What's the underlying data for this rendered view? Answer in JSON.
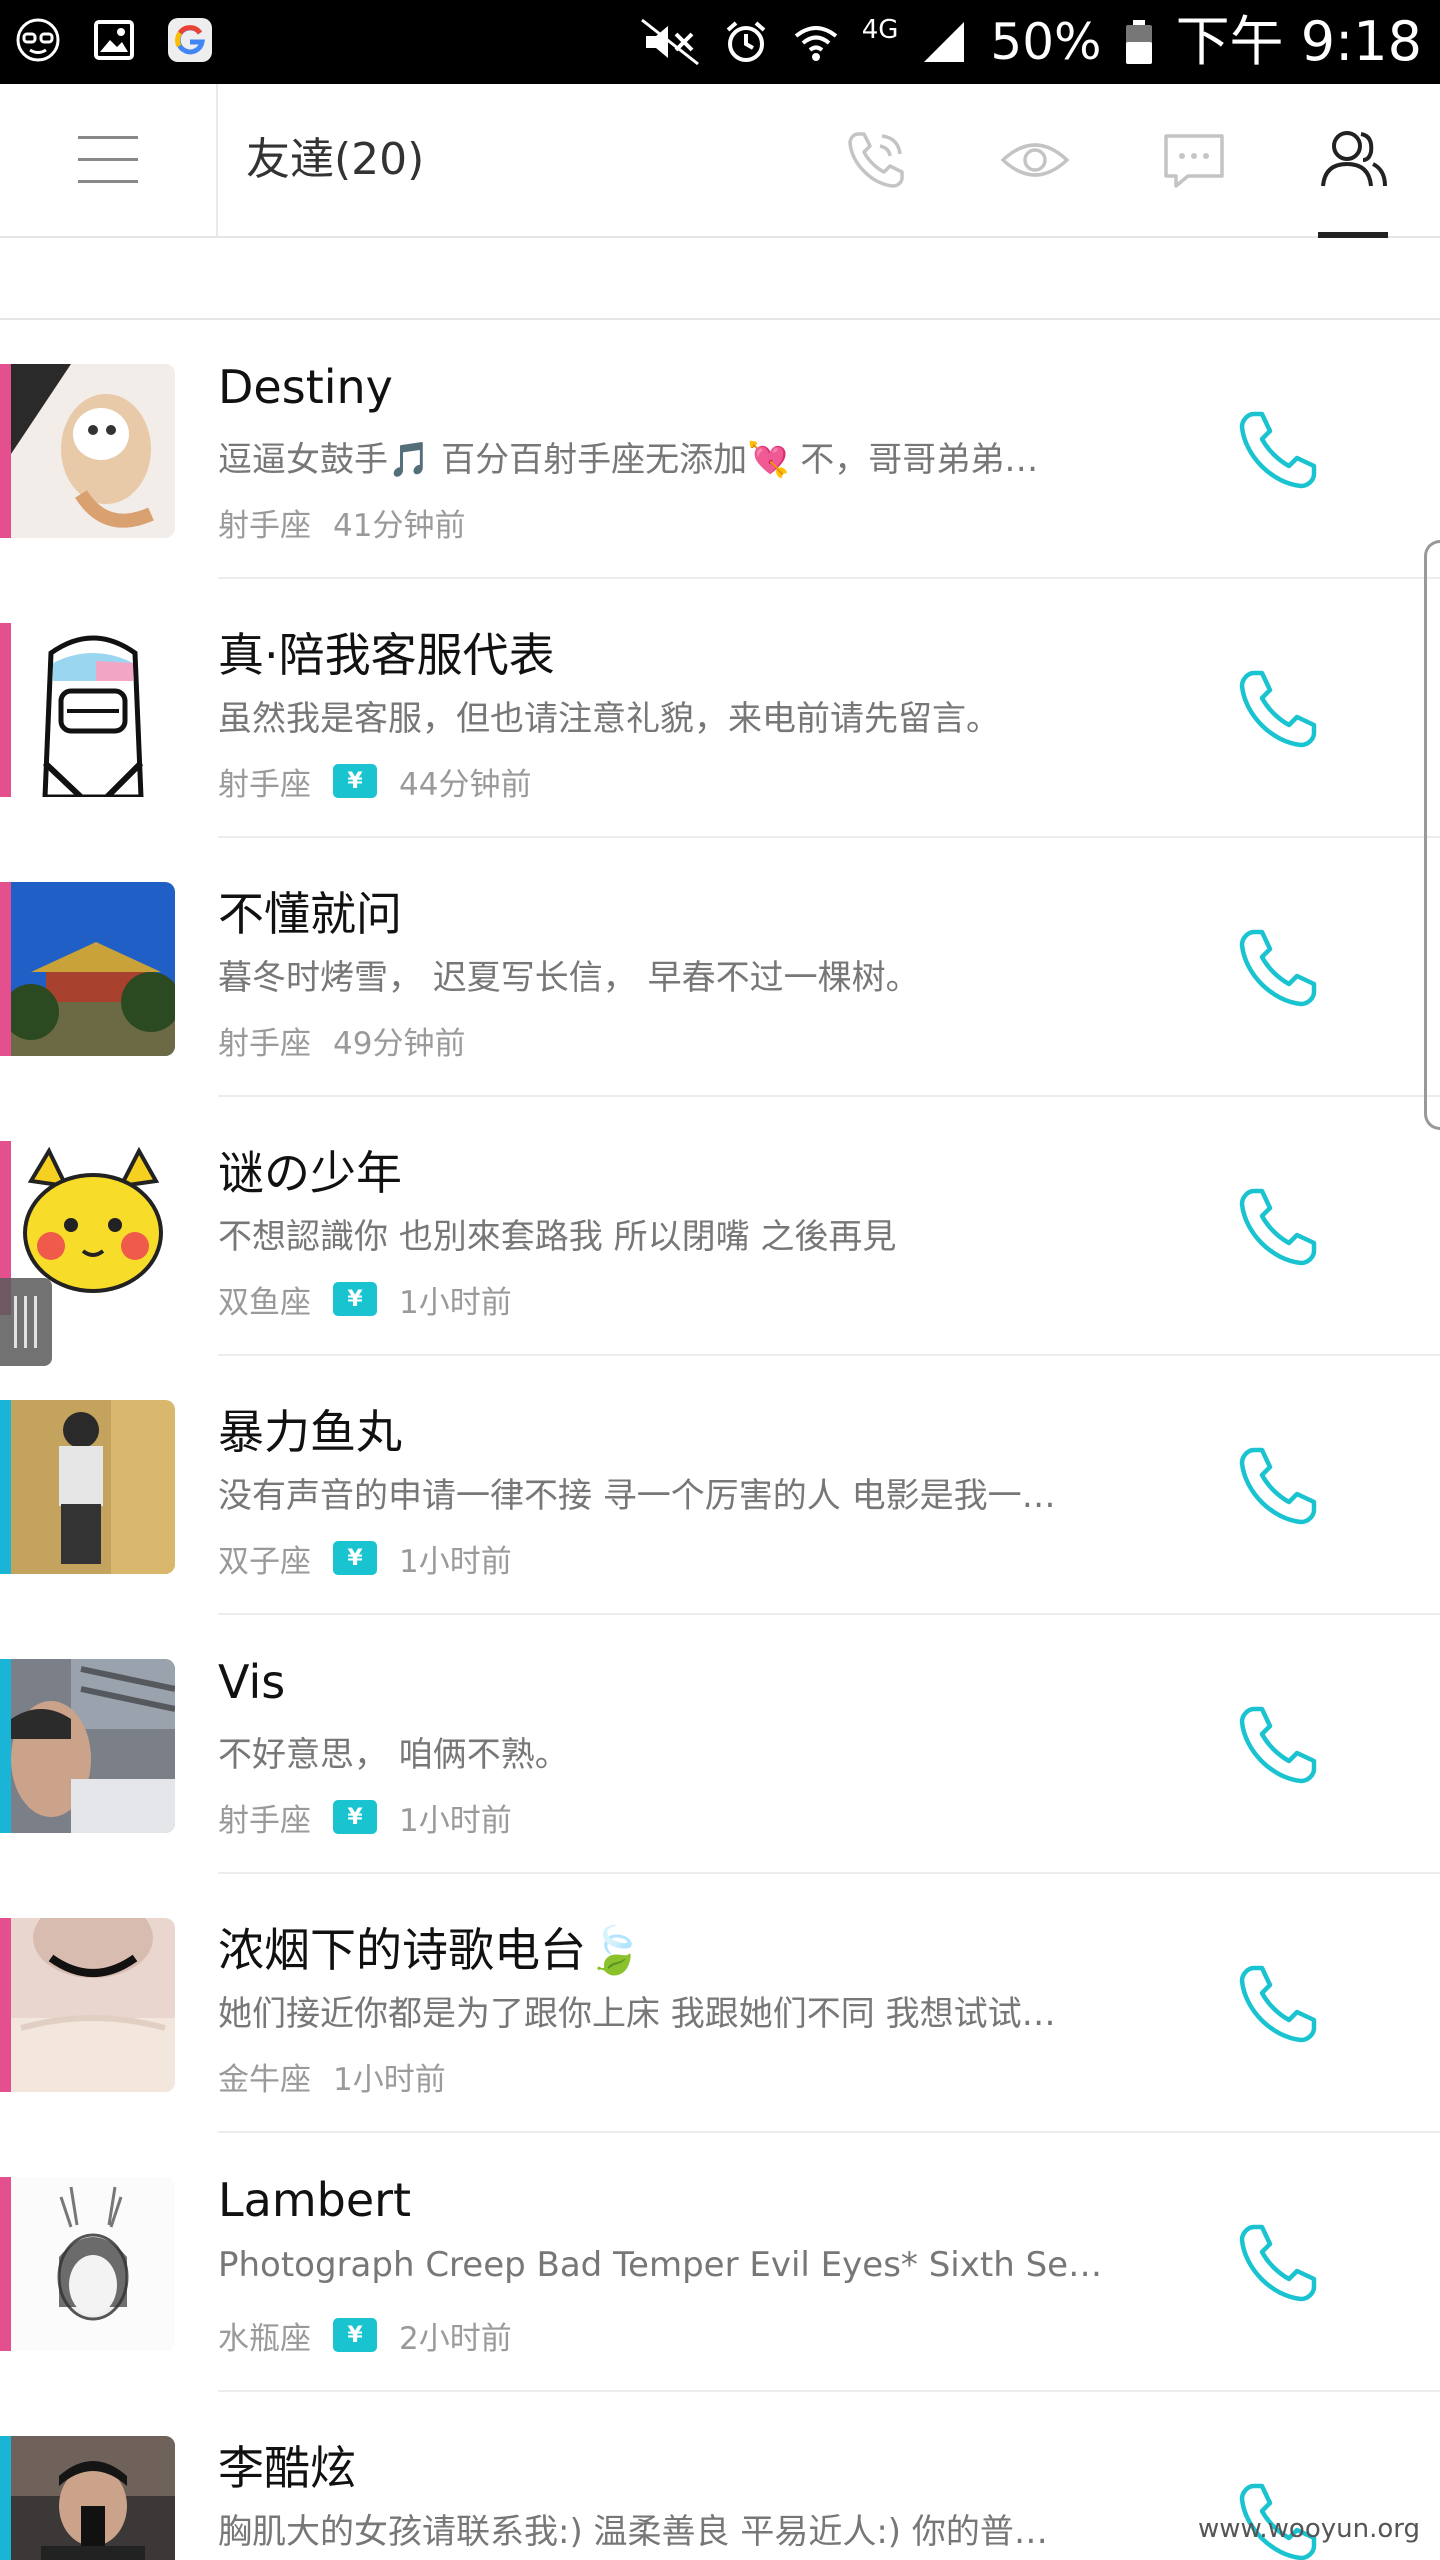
{
  "status_bar": {
    "icons_left": [
      "incognito-icon",
      "gallery-icon",
      "google-app-icon"
    ],
    "icons_right": [
      "mute-icon",
      "alarm-icon",
      "wifi-icon",
      "signal-4g-icon",
      "battery-icon"
    ],
    "network": "4G",
    "battery": "50%",
    "time": "下午 9:18"
  },
  "header": {
    "title": "友達(20)",
    "tabs": [
      "call-tab",
      "visitors-tab",
      "messages-tab",
      "friends-tab"
    ],
    "active_tab": "friends-tab",
    "accent_color": "#1ac3d0"
  },
  "friends": [
    {
      "name": "Destiny",
      "bio": "逗逼女鼓手🎵 百分百射手座无添加💘 不，哥哥弟弟…",
      "sign": "射手座",
      "vip": false,
      "time": "41分钟前",
      "gender_color": "#e4508e"
    },
    {
      "name": "真·陪我客服代表",
      "bio": "虽然我是客服，但也请注意礼貌，来电前请先留言。",
      "sign": "射手座",
      "vip": true,
      "time": "44分钟前",
      "gender_color": "#e4508e"
    },
    {
      "name": "不懂就问",
      "bio": "暮冬时烤雪， 迟夏写长信， 早春不过一棵树。",
      "sign": "射手座",
      "vip": false,
      "time": "49分钟前",
      "gender_color": "#e4508e"
    },
    {
      "name": "谜の少年",
      "bio": "不想認識你 也別來套路我 所以閉嘴 之後再見",
      "sign": "双鱼座",
      "vip": true,
      "time": "1小时前",
      "gender_color": "#e4508e"
    },
    {
      "name": "暴力鱼丸",
      "bio": "没有声音的申请一律不接 寻一个厉害的人 电影是我一…",
      "sign": "双子座",
      "vip": true,
      "time": "1小时前",
      "gender_color": "#1ab5d6"
    },
    {
      "name": "Vis",
      "bio": "不好意思， 咱俩不熟。",
      "sign": "射手座",
      "vip": true,
      "time": "1小时前",
      "gender_color": "#1ab5d6"
    },
    {
      "name": "浓烟下的诗歌电台🍃",
      "bio": "她们接近你都是为了跟你上床 我跟她们不同 我想试试…",
      "sign": "金牛座",
      "vip": false,
      "time": "1小时前",
      "gender_color": "#e4508e"
    },
    {
      "name": "Lambert",
      "bio": " Photograph Creep Bad Temper Evil Eyes*  Sixth Se…",
      "sign": "水瓶座",
      "vip": true,
      "time": "2小时前",
      "gender_color": "#e4508e"
    },
    {
      "name": "李酷炫",
      "bio": "胸肌大的女孩请联系我:)  温柔善良 平易近人:)  你的普…",
      "sign": "",
      "vip": false,
      "time": "",
      "gender_color": "#1ab5d6"
    }
  ],
  "vip_badge_label": "¥",
  "watermark": "www.wooyun.org"
}
